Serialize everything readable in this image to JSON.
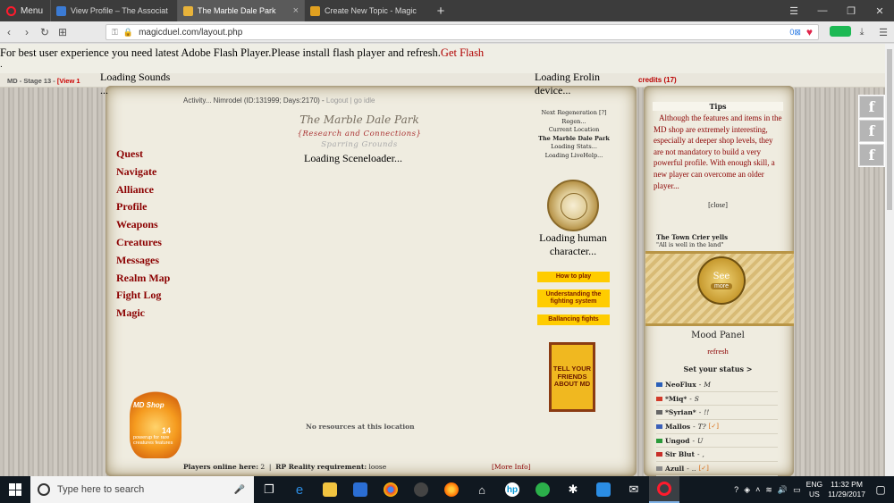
{
  "browser": {
    "menu_label": "Menu",
    "tabs": [
      {
        "label": "View Profile – The Associat",
        "icon_color": "#3b7bd4"
      },
      {
        "label": "The Marble Dale Park",
        "icon_color": "#e8b33a"
      },
      {
        "label": "Create New Topic - Magic",
        "icon_color": "#e0a020"
      }
    ],
    "url": "magicduel.com/layout.php",
    "vpn_badge": "0"
  },
  "page": {
    "flash_message": "For best user experience you need latest Adobe Flash Player.Please install flash player and refresh.",
    "get_flash": "Get Flash",
    "dot": ".",
    "stage": "MD - Stage 13 -",
    "view": "[View 1",
    "credits": "credits (17)",
    "loading_sounds": "Loading Sounds",
    "ellipsis": "...",
    "loading_erolin": "Loading Erolin device...",
    "activity": "Activity... Nimrodel (ID:131999; Days:2170) -",
    "logout": "Logout",
    "go_idle": "| go idle",
    "location_title": "The Marble Dale Park",
    "location_sub": "{Research and Connections}",
    "location_sub2": "Sparring Grounds",
    "scene_loader": "Loading Sceneloader...",
    "nav": [
      "Quest",
      "Navigate",
      "Alliance",
      "Profile",
      "Weapons",
      "Creatures",
      "Messages",
      "Realm Map",
      "Fight Log",
      "Magic"
    ],
    "no_resources": "No resources at this location",
    "players_online_label": "Players online here:",
    "players_online_value": "2",
    "rp_label": "RP Reality requirement:",
    "rp_value": "loose",
    "more_info": "[More Info]",
    "md_shop": {
      "label": "MD Shop",
      "number": "14",
      "note": "powerup for rare creatures features"
    },
    "regen": {
      "next_regen": "Next Regeneration [?]",
      "regen": "Regen...",
      "current_location": "Current Location",
      "location_name": "The Marble Dale Park",
      "loading_stats": "Loading Stats...",
      "loading_livehelp": "Loading LiveHelp..."
    },
    "loading_char": "Loading human character...",
    "buttons": {
      "how_to_play": "How to play",
      "understanding": "Understanding the fighting system",
      "balancing": "Ballancing fights"
    },
    "tell_friends": "TELL YOUR FRIENDS ABOUT MD"
  },
  "right_panel": {
    "tips_title": "Tips",
    "tips_body": "Although the features and items in the MD shop are extremely interesting, especially at deeper shop levels, they are not mandatory to build a very powerful profile. With enough skill, a new player can overcome an older player...",
    "tips_close": "[close]",
    "crier_head": "The Town Crier yells",
    "crier_msg": "\"All is well in the land\"",
    "see": "See",
    "more": "more",
    "mood_title": "Mood Panel",
    "mood_refresh": "refresh",
    "set_status": "Set your status >",
    "players": [
      {
        "name": "NeoFlux",
        "status": "M",
        "badge": "",
        "flag": "#2a5fb8"
      },
      {
        "name": "*Miq*",
        "status": "S",
        "badge": "",
        "flag": "#d23a2a"
      },
      {
        "name": "*Syrian*",
        "status": "!!",
        "badge": "",
        "flag": "#666666"
      },
      {
        "name": "Mallos",
        "status": "T?",
        "badge": "[✓]",
        "flag": "#3b5fb8"
      },
      {
        "name": "Ungod",
        "status": "U",
        "badge": "",
        "flag": "#2a9a3a"
      },
      {
        "name": "Sir Blut",
        "status": ",",
        "badge": "",
        "flag": "#c8302a"
      },
      {
        "name": "Azull",
        "status": "..",
        "badge": "[✓]",
        "flag": "#888888"
      }
    ]
  },
  "taskbar": {
    "search_placeholder": "Type here to search",
    "lang_line1": "ENG",
    "lang_line2": "US",
    "time": "11:32 PM",
    "date": "11/29/2017"
  }
}
